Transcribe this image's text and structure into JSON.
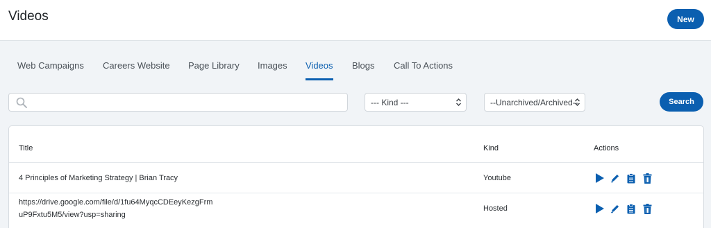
{
  "header": {
    "title": "Videos",
    "new_label": "New"
  },
  "tabs": [
    {
      "label": "Web Campaigns",
      "active": false
    },
    {
      "label": "Careers Website",
      "active": false
    },
    {
      "label": "Page Library",
      "active": false
    },
    {
      "label": "Images",
      "active": false
    },
    {
      "label": "Videos",
      "active": true
    },
    {
      "label": "Blogs",
      "active": false
    },
    {
      "label": "Call To Actions",
      "active": false
    }
  ],
  "filters": {
    "search_value": "",
    "kind_selected": "--- Kind ---",
    "archive_selected": "--Unarchived/Archived--",
    "search_button": "Search"
  },
  "table": {
    "columns": [
      "Title",
      "Kind",
      "Actions"
    ],
    "rows": [
      {
        "title_line1": "4 Principles of Marketing Strategy | Brian Tracy",
        "title_line2": "",
        "kind": "Youtube"
      },
      {
        "title_line1": "https://drive.google.com/file/d/1fu64MyqcCDEeyKezgFrm",
        "title_line2": "uP9Fxtu5M5/view?usp=sharing",
        "kind": "Hosted"
      }
    ]
  },
  "colors": {
    "accent": "#0b5fb0",
    "page_bg": "#f1f4f7"
  },
  "icons": [
    "search-icon",
    "chevron-updown-icon",
    "play-icon",
    "edit-icon",
    "clipboard-icon",
    "trash-icon"
  ]
}
